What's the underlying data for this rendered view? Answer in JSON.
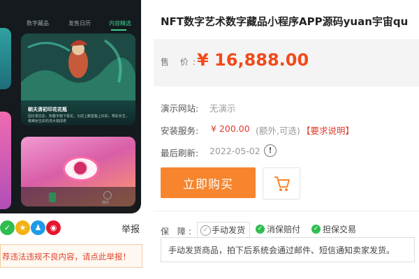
{
  "preview": {
    "tabs": [
      "数字藏品",
      "发售日历",
      "内容精选"
    ],
    "card1_title": "朝夫清初印花花瓶",
    "card1_desc": "固伦相五彩，知春平衡下看花，为前上鹏善集上红彩，笑彩长生，雍嗽树五彩的流大错成老",
    "nav_label": "我的"
  },
  "share": {
    "icons": [
      {
        "name": "wechat-share-icon",
        "color": "#2fbd4f",
        "glyph": "✓"
      },
      {
        "name": "qzone-share-icon",
        "color": "#f4b315",
        "glyph": "★"
      },
      {
        "name": "qq-share-icon",
        "color": "#1e9be8",
        "glyph": "♟"
      },
      {
        "name": "weibo-share-icon",
        "color": "#e6162d",
        "glyph": "◉"
      }
    ],
    "report": "举报"
  },
  "notice": "荐违法违规不良内容，请点此举报！",
  "product": {
    "title": "NFT数字艺术数字藏品小程序APP源码yuan宇宙qu",
    "price_label": "售 价:",
    "price": "¥ 16,888.00",
    "demo_label": "演示网站:",
    "demo_value": "无演示",
    "install_label": "安装服务:",
    "install_price": "¥ 200.00",
    "install_note": "(额外,可选)",
    "install_link": "【要求说明】",
    "refresh_label": "最后刷新:",
    "refresh_value": "2022-05-02",
    "buy_label": "立即购买"
  },
  "guarantee": {
    "label": "保 障:",
    "tags": [
      "手动发货",
      "消保赔付",
      "担保交易"
    ],
    "desc": "手动发货商品，拍下后系统会通过邮件、短信通知卖家发货。"
  },
  "colors": {
    "accent": "#f6852d",
    "price": "#f24a1a",
    "green": "#2fbd4f"
  }
}
